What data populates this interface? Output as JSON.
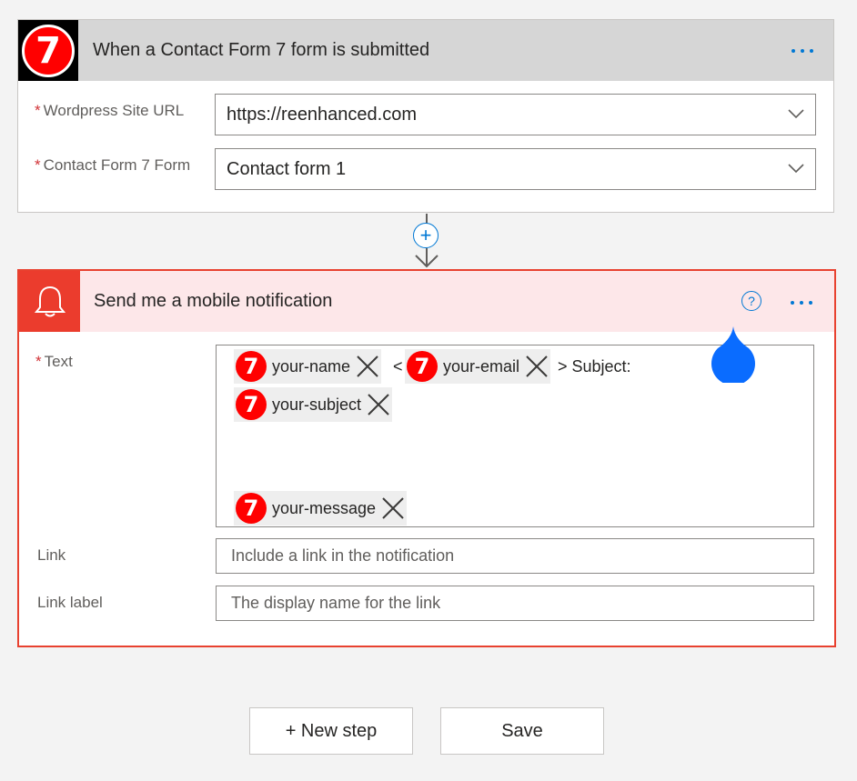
{
  "trigger": {
    "title": "When a Contact Form 7 form is submitted",
    "logo_text": "7",
    "fields": [
      {
        "label": "Wordpress Site URL",
        "required": "*",
        "value": "https://reenhanced.com"
      },
      {
        "label": "Contact Form 7 Form",
        "required": "*",
        "value": "Contact form 1"
      }
    ],
    "more_icon": "more-dots-icon"
  },
  "connector": {
    "add_symbol": "+"
  },
  "action": {
    "title": "Send me a mobile notification",
    "icon": "bell-icon",
    "help_symbol": "?",
    "text_field": {
      "label": "Text",
      "required": "*",
      "tokens": [
        {
          "badge": "7",
          "label": "your-name"
        },
        {
          "badge": "7",
          "label": "your-email"
        },
        {
          "badge": "7",
          "label": "your-subject"
        },
        {
          "badge": "7",
          "label": "your-message"
        }
      ],
      "literals": {
        "lt": "<",
        "gt_subject": "> Subject:"
      }
    },
    "link_field": {
      "label": "Link",
      "placeholder": "Include a link in the notification"
    },
    "link_label_field": {
      "label": "Link label",
      "placeholder": "The display name for the link"
    }
  },
  "buttons": {
    "new_step": "+ New step",
    "save": "Save"
  },
  "colors": {
    "accent": "#0078d4",
    "cf7_red": "#ff0000",
    "action_red": "#eb3c2d",
    "action_header_bg": "#fde7e9",
    "trigger_header_bg": "#d6d6d6"
  }
}
